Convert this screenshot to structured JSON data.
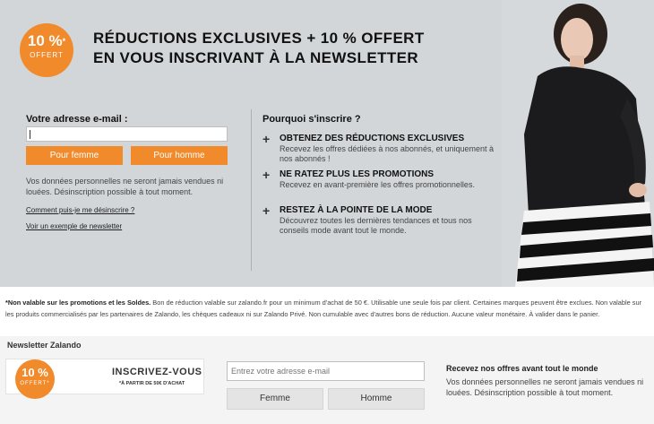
{
  "hero": {
    "badge": {
      "percent": "10 %",
      "sup": "*",
      "label": "OFFERT"
    },
    "headline_line1": "RÉDUCTIONS EXCLUSIVES + 10 % OFFERT",
    "headline_line2": "EN VOUS INSCRIVANT À LA NEWSLETTER"
  },
  "signup": {
    "email_label": "Votre adresse e-mail :",
    "email_value": "",
    "button_femme": "Pour femme",
    "button_homme": "Pour homme",
    "privacy": "Vos données personnelles ne seront jamais vendues ni louées. Désinscription possible à tout moment.",
    "link_unsubscribe": "Comment puis-je me désinscrire ?",
    "link_example": "Voir un exemple de newsletter"
  },
  "benefits": {
    "title": "Pourquoi s'inscrire ?",
    "items": [
      {
        "title": "OBTENEZ DES RÉDUCTIONS EXCLUSIVES",
        "text": "Recevez les offres dédiées à nos abonnés, et uniquement à nos abonnés !"
      },
      {
        "title": "NE RATEZ PLUS LES PROMOTIONS",
        "text": "Recevez en avant-première les offres promotionnelles."
      },
      {
        "title": "RESTEZ À LA POINTE DE LA MODE",
        "text": "Découvrez toutes les dernières tendances et tous nos conseils mode avant tout le monde."
      }
    ]
  },
  "disclaimer": {
    "bold": "*Non valable sur les promotions et les Soldes.",
    "text": " Bon de réduction valable sur zalando.fr pour un minimum d'achat de 50 €. Utilisable une seule fois par client. Certaines marques peuvent être exclues. Non valable sur les produits commercialisés par les partenaires de Zalando, les chèques cadeaux ni sur Zalando Privé. Non cumulable avec d'autres bons de réduction. Aucune valeur monétaire. À valider dans le panier."
  },
  "footer": {
    "title": "Newsletter Zalando",
    "badge_percent": "10 %",
    "badge_label": "OFFERT*",
    "inscrivez": "INSCRIVEZ-VOUS",
    "partir": "*À PARTIR DE 50€ D'ACHAT",
    "input_placeholder": "Entrez votre adresse e-mail",
    "button_femme": "Femme",
    "button_homme": "Homme",
    "right_title": "Recevez nos offres avant tout le monde",
    "right_text": "Vos données personnelles ne seront jamais vendues ni louées. Désinscription possible à tout moment."
  },
  "colors": {
    "accent": "#f08a2a",
    "hero_bg": "#d3d6d9",
    "footer_bg": "#f4f4f4"
  }
}
